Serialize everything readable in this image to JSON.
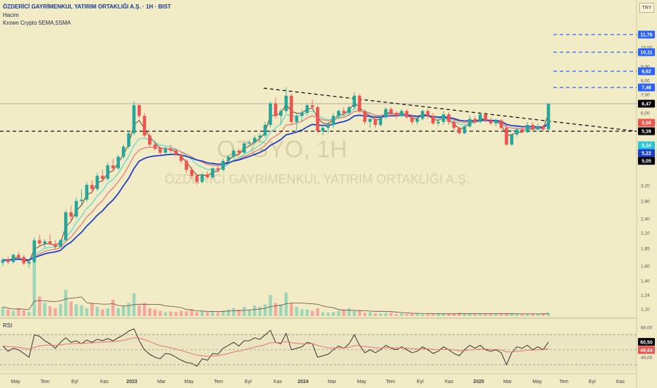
{
  "header": {
    "title": "ÖZDERİCİ GAYRİMENKUL YATIRIM ORTAKLIĞI A.Ş. · 1H · BIST",
    "volume_label": "Hacim",
    "indicator_label": "Krown Crypto 5EMA,5SMA"
  },
  "currency": "TRY",
  "rsi_label": "RSI",
  "watermark": {
    "symbol": "OZGYO, 1H",
    "name": "ÖZDERİCİ GAYRİMENKUL YATIRIM ORTAKLIĞI A.Ş."
  },
  "colors": {
    "up": "#26a69a",
    "down": "#ef5350",
    "ema_blue": "#1e3fc8",
    "ema_cyan": "#5ad8d0",
    "ema_red": "#e57373",
    "trend": "#111111",
    "target": "#2962ff",
    "rsi_line": "#222222",
    "rsi_ma": "#e57373"
  },
  "chart_data": {
    "type": "candlestick",
    "x_ticks": [
      "May",
      "Tem",
      "Eyl",
      "Kas",
      "2023",
      "Mar",
      "May",
      "Tem",
      "Eyl",
      "Kas",
      "2024",
      "Mar",
      "May",
      "Tem",
      "Eyl",
      "Kas",
      "2025",
      "Mar",
      "May",
      "Tem",
      "Eyl",
      "Kas"
    ],
    "price_ticks": [
      "14,00",
      "11,76",
      "10,50",
      "10,11",
      "9,00",
      "8,62",
      "8,00",
      "7,46",
      "7,00",
      "6,47",
      "6,00",
      "5,50",
      "5,39",
      "5,34",
      "5,22",
      "5,05",
      "3,20",
      "2,80",
      "2,40",
      "2,10",
      "1,85",
      "1,60",
      "1,40",
      "1,24",
      "1,10"
    ],
    "price_plain_ticks": [
      14.0,
      10.5,
      9.0,
      8.0,
      7.0,
      6.0,
      3.2,
      2.8,
      2.4,
      2.1,
      1.85,
      1.6,
      1.4,
      1.24,
      1.1
    ],
    "price_labels": [
      {
        "text": "11,76",
        "value": 11.76,
        "bg": "#2962ff",
        "fg": "#ffffff"
      },
      {
        "text": "10,11",
        "value": 10.11,
        "bg": "#2962ff",
        "fg": "#ffffff"
      },
      {
        "text": "8,62",
        "value": 8.62,
        "bg": "#2962ff",
        "fg": "#ffffff"
      },
      {
        "text": "7,46",
        "value": 7.46,
        "bg": "#2962ff",
        "fg": "#ffffff"
      },
      {
        "text": "6,47",
        "value": 6.47,
        "bg": "#000000",
        "fg": "#ffffff"
      },
      {
        "text": "5,50",
        "value": 5.5,
        "bg": "#ef5350",
        "fg": "#ffffff"
      },
      {
        "text": "5,39",
        "value": 5.39,
        "bg": "#000000",
        "fg": "#ffffff"
      },
      {
        "text": "5,34",
        "value": 5.34,
        "bg": "#26c6da",
        "fg": "#ffffff"
      },
      {
        "text": "5,22",
        "value": 5.22,
        "bg": "#1e3fc8",
        "fg": "#ffffff"
      },
      {
        "text": "5,05",
        "value": 5.05,
        "bg": "#000000",
        "fg": "#ffffff"
      }
    ],
    "target_levels": [
      11.76,
      10.11,
      8.62,
      7.46
    ],
    "support_level": 5.39,
    "last_price": 6.47,
    "trendline": {
      "from": {
        "time": "Eyl 2023",
        "price": 7.6
      },
      "to": {
        "time": "Eyl 2025",
        "price": 5.45
      }
    },
    "rsi_ticks": [
      "80,00",
      "60,50",
      "49,64",
      "40,00"
    ],
    "rsi_last": 60.5,
    "rsi_ma_last": 49.64,
    "rsi_levels": [
      70,
      50,
      30
    ],
    "candles": [
      [
        1.65,
        1.72,
        1.6,
        1.69
      ],
      [
        1.69,
        1.74,
        1.63,
        1.66
      ],
      [
        1.66,
        1.78,
        1.64,
        1.76
      ],
      [
        1.76,
        1.8,
        1.7,
        1.73
      ],
      [
        1.73,
        1.76,
        1.62,
        1.64
      ],
      [
        1.64,
        1.7,
        1.58,
        1.66
      ],
      [
        1.66,
        2.05,
        1.64,
        2.0
      ],
      [
        2.0,
        2.1,
        1.9,
        1.94
      ],
      [
        1.94,
        2.02,
        1.86,
        1.98
      ],
      [
        1.98,
        2.1,
        1.92,
        1.93
      ],
      [
        1.93,
        2.0,
        1.84,
        1.88
      ],
      [
        1.88,
        2.02,
        1.86,
        2.0
      ],
      [
        2.0,
        2.6,
        1.98,
        2.55
      ],
      [
        2.55,
        2.7,
        2.35,
        2.45
      ],
      [
        2.45,
        2.9,
        2.4,
        2.82
      ],
      [
        2.82,
        3.1,
        2.7,
        2.85
      ],
      [
        2.85,
        3.3,
        2.8,
        3.2
      ],
      [
        3.2,
        3.35,
        3.0,
        3.1
      ],
      [
        3.1,
        3.6,
        3.05,
        3.5
      ],
      [
        3.5,
        3.7,
        3.3,
        3.4
      ],
      [
        3.4,
        3.95,
        3.35,
        3.85
      ],
      [
        3.85,
        4.1,
        3.7,
        3.75
      ],
      [
        3.75,
        4.3,
        3.7,
        4.2
      ],
      [
        4.2,
        4.8,
        4.1,
        4.7
      ],
      [
        4.7,
        5.4,
        4.6,
        5.3
      ],
      [
        5.3,
        6.6,
        5.2,
        6.4
      ],
      [
        6.4,
        6.5,
        5.8,
        5.9
      ],
      [
        5.9,
        6.0,
        5.1,
        5.2
      ],
      [
        5.2,
        5.3,
        4.7,
        4.8
      ],
      [
        4.8,
        5.0,
        4.5,
        4.6
      ],
      [
        4.6,
        4.7,
        4.3,
        4.4
      ],
      [
        4.4,
        4.7,
        4.3,
        4.6
      ],
      [
        4.6,
        4.8,
        4.4,
        4.5
      ],
      [
        4.5,
        4.6,
        4.2,
        4.3
      ],
      [
        4.3,
        4.4,
        3.9,
        4.0
      ],
      [
        4.0,
        4.1,
        3.6,
        3.7
      ],
      [
        3.7,
        3.8,
        3.4,
        3.5
      ],
      [
        3.5,
        3.55,
        3.2,
        3.3
      ],
      [
        3.3,
        3.6,
        3.25,
        3.55
      ],
      [
        3.55,
        3.65,
        3.4,
        3.45
      ],
      [
        3.45,
        3.8,
        3.4,
        3.75
      ],
      [
        3.75,
        3.85,
        3.6,
        3.7
      ],
      [
        3.7,
        4.1,
        3.65,
        4.0
      ],
      [
        4.0,
        4.3,
        3.95,
        4.2
      ],
      [
        4.2,
        4.6,
        4.1,
        4.5
      ],
      [
        4.5,
        4.6,
        4.3,
        4.4
      ],
      [
        4.4,
        4.9,
        4.35,
        4.85
      ],
      [
        4.85,
        5.0,
        4.7,
        4.9
      ],
      [
        4.9,
        5.2,
        4.8,
        5.1
      ],
      [
        5.1,
        5.3,
        4.9,
        5.2
      ],
      [
        5.2,
        5.7,
        5.1,
        5.6
      ],
      [
        5.6,
        6.6,
        5.5,
        6.5
      ],
      [
        6.5,
        6.8,
        5.8,
        5.9
      ],
      [
        5.9,
        6.2,
        5.6,
        6.1
      ],
      [
        6.1,
        7.5,
        6.0,
        6.9
      ],
      [
        6.9,
        7.0,
        5.6,
        5.7
      ],
      [
        5.7,
        6.0,
        5.4,
        5.9
      ],
      [
        5.9,
        6.2,
        5.7,
        6.0
      ],
      [
        6.0,
        6.5,
        5.9,
        6.4
      ],
      [
        6.4,
        6.7,
        6.2,
        6.3
      ],
      [
        6.3,
        6.4,
        5.3,
        5.4
      ],
      [
        5.4,
        5.6,
        5.2,
        5.5
      ],
      [
        5.5,
        5.7,
        5.3,
        5.6
      ],
      [
        5.6,
        6.0,
        5.5,
        5.9
      ],
      [
        5.9,
        6.2,
        5.8,
        6.1
      ],
      [
        6.1,
        6.3,
        5.9,
        6.0
      ],
      [
        6.0,
        6.4,
        5.9,
        6.3
      ],
      [
        6.3,
        7.1,
        6.2,
        6.9
      ],
      [
        6.9,
        7.0,
        6.0,
        6.1
      ],
      [
        6.1,
        6.2,
        5.6,
        5.7
      ],
      [
        5.7,
        5.9,
        5.5,
        5.8
      ],
      [
        5.8,
        5.9,
        5.5,
        5.6
      ],
      [
        5.6,
        5.9,
        5.55,
        5.85
      ],
      [
        5.85,
        6.3,
        5.8,
        6.2
      ],
      [
        6.2,
        6.3,
        5.9,
        6.0
      ],
      [
        6.0,
        6.1,
        5.8,
        5.9
      ],
      [
        5.9,
        6.2,
        5.85,
        6.1
      ],
      [
        6.1,
        6.2,
        5.8,
        5.85
      ],
      [
        5.85,
        5.95,
        5.6,
        5.7
      ],
      [
        5.7,
        5.9,
        5.6,
        5.8
      ],
      [
        5.8,
        6.2,
        5.75,
        6.1
      ],
      [
        6.1,
        6.2,
        5.8,
        5.9
      ],
      [
        5.9,
        6.0,
        5.6,
        5.65
      ],
      [
        5.65,
        5.8,
        5.55,
        5.7
      ],
      [
        5.7,
        6.1,
        5.6,
        5.95
      ],
      [
        5.95,
        6.05,
        5.6,
        5.7
      ],
      [
        5.7,
        5.8,
        5.4,
        5.5
      ],
      [
        5.5,
        5.55,
        5.25,
        5.3
      ],
      [
        5.3,
        5.6,
        5.25,
        5.55
      ],
      [
        5.55,
        5.9,
        5.5,
        5.8
      ],
      [
        5.8,
        5.9,
        5.65,
        5.7
      ],
      [
        5.7,
        6.0,
        5.65,
        5.95
      ],
      [
        5.95,
        6.05,
        5.7,
        5.75
      ],
      [
        5.75,
        5.85,
        5.6,
        5.65
      ],
      [
        5.65,
        5.8,
        5.55,
        5.75
      ],
      [
        5.75,
        5.8,
        5.45,
        5.5
      ],
      [
        5.5,
        5.6,
        4.75,
        4.8
      ],
      [
        4.8,
        5.3,
        4.75,
        5.25
      ],
      [
        5.25,
        5.5,
        5.15,
        5.45
      ],
      [
        5.45,
        5.55,
        5.3,
        5.35
      ],
      [
        5.35,
        5.7,
        5.3,
        5.6
      ],
      [
        5.6,
        5.7,
        5.4,
        5.45
      ],
      [
        5.45,
        5.65,
        5.4,
        5.55
      ],
      [
        5.55,
        5.6,
        5.4,
        5.45
      ],
      [
        5.45,
        6.5,
        5.4,
        6.47
      ]
    ],
    "volume": [
      0.14,
      0.1,
      0.08,
      0.12,
      0.09,
      0.06,
      1.0,
      0.3,
      0.2,
      0.15,
      0.12,
      0.18,
      0.4,
      0.22,
      0.18,
      0.16,
      0.12,
      0.2,
      0.14,
      0.1,
      0.12,
      0.25,
      0.12,
      0.16,
      0.2,
      0.35,
      0.16,
      0.2,
      0.12,
      0.1,
      0.08,
      0.06,
      0.07,
      0.06,
      0.08,
      0.07,
      0.1,
      0.06,
      0.08,
      0.06,
      0.07,
      0.06,
      0.08,
      0.1,
      0.12,
      0.1,
      0.14,
      0.1,
      0.16,
      0.14,
      0.18,
      0.32,
      0.2,
      0.18,
      0.36,
      0.2,
      0.14,
      0.1,
      0.1,
      0.08,
      0.12,
      0.06,
      0.05,
      0.06,
      0.08,
      0.1,
      0.12,
      0.09,
      0.08,
      0.05,
      0.06,
      0.04,
      0.04,
      0.05,
      0.05,
      0.03,
      0.04,
      0.03,
      0.04,
      0.04,
      0.03,
      0.03,
      0.03,
      0.04,
      0.03,
      0.03,
      0.04,
      0.05,
      0.04,
      0.04,
      0.03,
      0.03,
      0.03,
      0.03,
      0.03,
      0.04,
      0.04,
      0.04,
      0.03,
      0.03,
      0.03,
      0.03,
      0.03,
      0.04,
      0.05
    ],
    "rsi": [
      55,
      48,
      52,
      50,
      45,
      40,
      70,
      68,
      62,
      58,
      52,
      60,
      66,
      60,
      62,
      58,
      63,
      60,
      64,
      62,
      65,
      62,
      66,
      70,
      75,
      78,
      62,
      50,
      44,
      40,
      38,
      45,
      44,
      40,
      36,
      33,
      32,
      28,
      38,
      36,
      45,
      44,
      52,
      56,
      60,
      55,
      62,
      62,
      66,
      64,
      70,
      76,
      60,
      58,
      72,
      50,
      52,
      54,
      60,
      58,
      40,
      42,
      44,
      50,
      55,
      52,
      58,
      70,
      56,
      46,
      50,
      46,
      50,
      56,
      52,
      50,
      54,
      50,
      46,
      48,
      54,
      50,
      45,
      48,
      54,
      50,
      45,
      42,
      50,
      56,
      52,
      56,
      50,
      48,
      50,
      46,
      30,
      46,
      54,
      52,
      56,
      50,
      54,
      50,
      60.5
    ]
  }
}
